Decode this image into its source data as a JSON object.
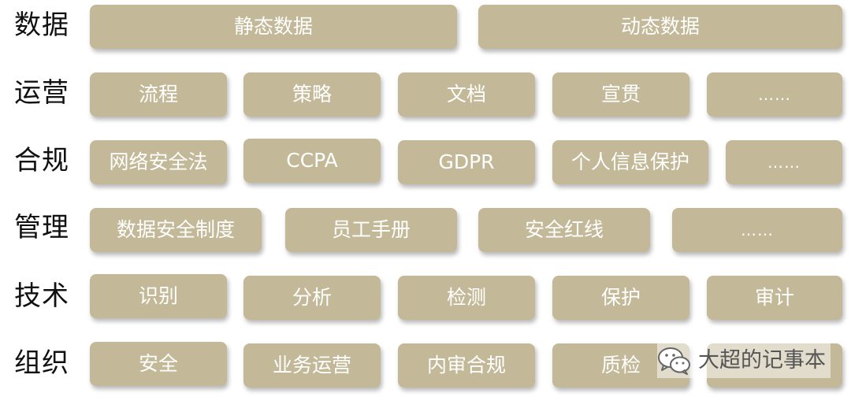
{
  "rows": {
    "data": {
      "label": "数据",
      "items": [
        "静态数据",
        "动态数据"
      ]
    },
    "operations": {
      "label": "运营",
      "items": [
        "流程",
        "策略",
        "文档",
        "宣贯",
        "……"
      ]
    },
    "compliance": {
      "label": "合规",
      "items": [
        "网络安全法",
        "CCPA",
        "GDPR",
        "个人信息保护",
        "……"
      ]
    },
    "management": {
      "label": "管理",
      "items": [
        "数据安全制度",
        "员工手册",
        "安全红线",
        "……"
      ]
    },
    "technology": {
      "label": "技术",
      "items": [
        "识别",
        "分析",
        "检测",
        "保护",
        "审计"
      ]
    },
    "organization": {
      "label": "组织",
      "items": [
        "安全",
        "业务运营",
        "内审合规",
        "质检",
        ""
      ]
    }
  },
  "watermark": {
    "text": "大超的记事本",
    "icon": "wechat-icon"
  },
  "colors": {
    "box": "#c3b897",
    "box_text": "#ffffff",
    "label": "#111111"
  }
}
